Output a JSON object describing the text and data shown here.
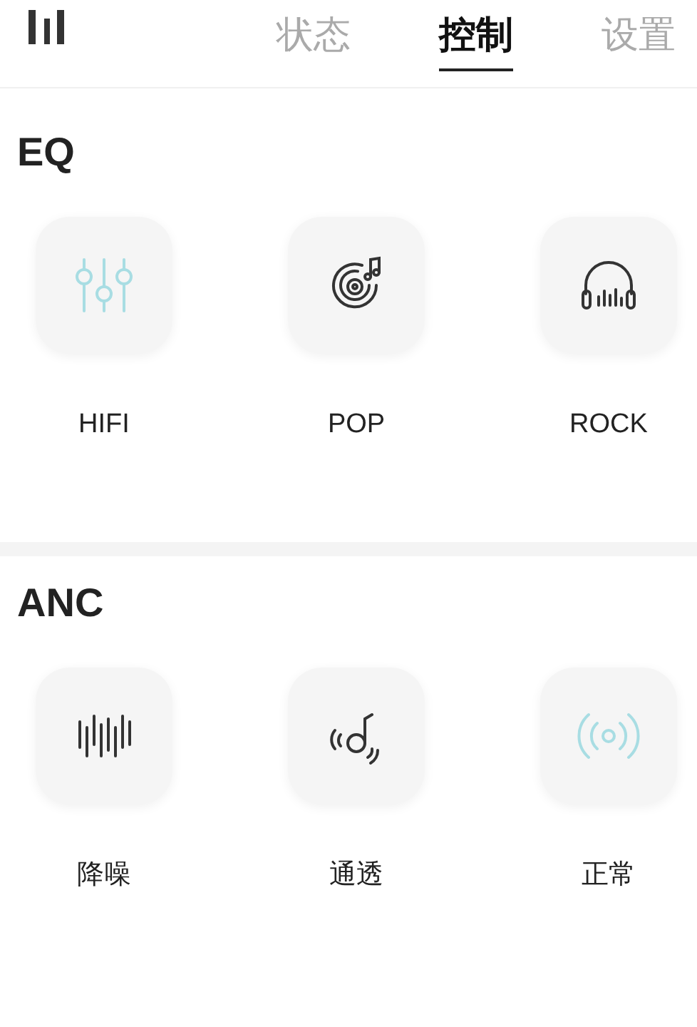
{
  "tabs": [
    {
      "label": "状态",
      "selected": false
    },
    {
      "label": "控制",
      "selected": true
    },
    {
      "label": "设置",
      "selected": false
    }
  ],
  "sections": [
    {
      "title": "EQ",
      "modes": [
        {
          "label": "HIFI",
          "kind": "sliders",
          "selected": true
        },
        {
          "label": "POP",
          "kind": "vinyl",
          "selected": false
        },
        {
          "label": "ROCK",
          "kind": "headphones",
          "selected": false
        }
      ]
    },
    {
      "title": "ANC",
      "modes": [
        {
          "label": "降噪",
          "kind": "bars",
          "selected": false
        },
        {
          "label": "通透",
          "kind": "transparent",
          "selected": false
        },
        {
          "label": "正常",
          "kind": "signal",
          "selected": true
        }
      ]
    }
  ]
}
